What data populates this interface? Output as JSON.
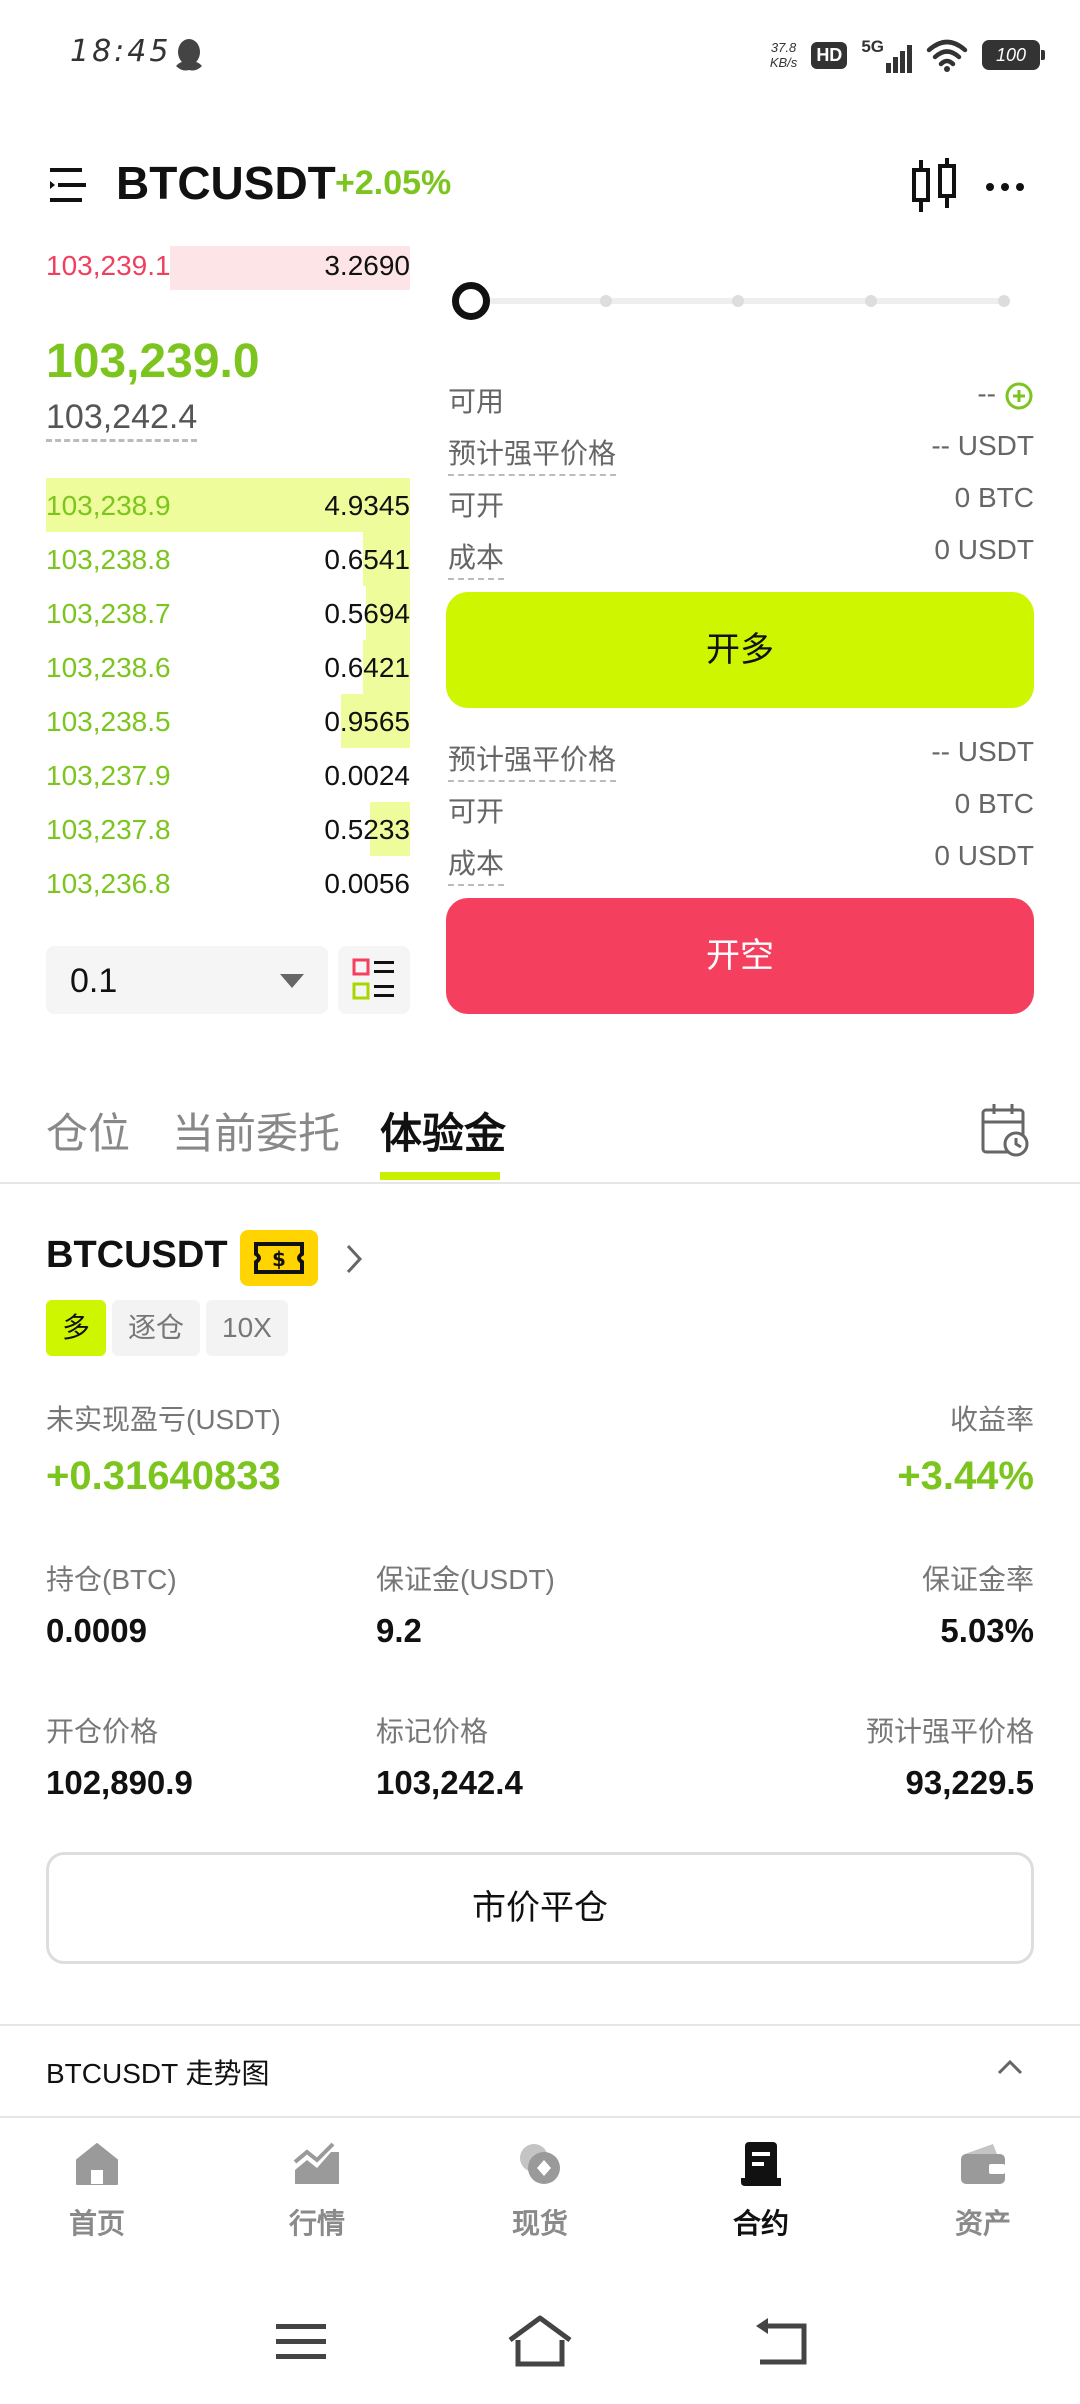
{
  "status_bar": {
    "time": "18:45",
    "net_speed_top": "37.8",
    "net_speed_bottom": "KB/s",
    "hd": "HD",
    "signal": "5G",
    "battery": "100"
  },
  "header": {
    "pair": "BTCUSDT",
    "change": "+2.05%"
  },
  "orderbook": {
    "ask": {
      "price": "103,239.1",
      "qty": "3.2690"
    },
    "last_price": "103,239.0",
    "mark_price": "103,242.4",
    "bids": [
      {
        "price": "103,238.9",
        "qty": "4.9345",
        "depth": 1.0
      },
      {
        "price": "103,238.8",
        "qty": "0.6541",
        "depth": 0.13
      },
      {
        "price": "103,238.7",
        "qty": "0.5694",
        "depth": 0.12
      },
      {
        "price": "103,238.6",
        "qty": "0.6421",
        "depth": 0.13
      },
      {
        "price": "103,238.5",
        "qty": "0.9565",
        "depth": 0.19
      },
      {
        "price": "103,237.9",
        "qty": "0.0024",
        "depth": 0.0
      },
      {
        "price": "103,237.8",
        "qty": "0.5233",
        "depth": 0.11
      },
      {
        "price": "103,236.8",
        "qty": "0.0056",
        "depth": 0.0
      }
    ],
    "qty_step": "0.1"
  },
  "trade": {
    "available_label": "可用",
    "available_value": "--",
    "long_info": [
      {
        "label": "预计强平价格",
        "value": "-- USDT",
        "dashed": true
      },
      {
        "label": "可开",
        "value": "0 BTC",
        "dashed": false
      },
      {
        "label": "成本",
        "value": "0 USDT",
        "dashed": true
      }
    ],
    "long_button": "开多",
    "short_info": [
      {
        "label": "预计强平价格",
        "value": "-- USDT",
        "dashed": true
      },
      {
        "label": "可开",
        "value": "0 BTC",
        "dashed": false
      },
      {
        "label": "成本",
        "value": "0 USDT",
        "dashed": true
      }
    ],
    "short_button": "开空"
  },
  "tabs": [
    "仓位",
    "当前委托",
    "体验金"
  ],
  "position": {
    "symbol": "BTCUSDT",
    "tags": [
      "多",
      "逐仓",
      "10X"
    ],
    "unrealized_label": "未实现盈亏(USDT)",
    "unrealized_value": "+0.31640833",
    "roe_label": "收益率",
    "roe_value": "+3.44%",
    "size_label": "持仓(BTC)",
    "size_value": "0.0009",
    "margin_label": "保证金(USDT)",
    "margin_value": "9.2",
    "margin_ratio_label": "保证金率",
    "margin_ratio_value": "5.03%",
    "entry_label": "开仓价格",
    "entry_value": "102,890.9",
    "mark_label": "标记价格",
    "mark_value": "103,242.4",
    "liq_label": "预计强平价格",
    "liq_value": "93,229.5",
    "close_button": "市价平仓"
  },
  "chart_section": {
    "title": "BTCUSDT 走势图"
  },
  "bottom_nav": [
    {
      "label": "首页",
      "icon": "home-icon",
      "active": false
    },
    {
      "label": "行情",
      "icon": "market-icon",
      "active": false
    },
    {
      "label": "现货",
      "icon": "spot-icon",
      "active": false
    },
    {
      "label": "合约",
      "icon": "contract-icon",
      "active": true
    },
    {
      "label": "资产",
      "icon": "wallet-icon",
      "active": false
    }
  ]
}
